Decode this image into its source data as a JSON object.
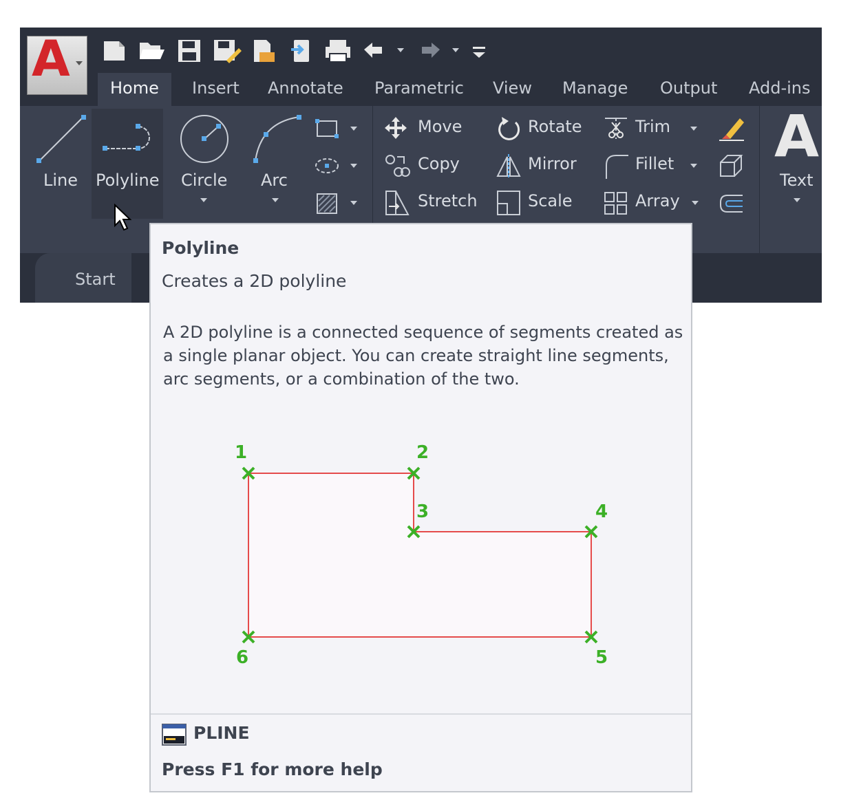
{
  "app_button": {
    "letter": "A"
  },
  "quick_access_icons": [
    "new-icon",
    "open-icon",
    "save-icon",
    "save-as-icon",
    "open-from-web-icon",
    "save-to-web-icon",
    "print-icon",
    "undo-icon",
    "redo-icon",
    "customize-qat-icon"
  ],
  "tabs": [
    {
      "label": "Home",
      "active": true
    },
    {
      "label": "Insert"
    },
    {
      "label": "Annotate"
    },
    {
      "label": "Parametric"
    },
    {
      "label": "View"
    },
    {
      "label": "Manage"
    },
    {
      "label": "Output"
    },
    {
      "label": "Add-ins"
    }
  ],
  "draw_panel": {
    "line": "Line",
    "polyline": "Polyline",
    "circle": "Circle",
    "arc": "Arc"
  },
  "modify_panel": {
    "move": "Move",
    "copy": "Copy",
    "stretch": "Stretch",
    "rotate": "Rotate",
    "mirror": "Mirror",
    "scale": "Scale",
    "trim": "Trim",
    "fillet": "Fillet",
    "array": "Array"
  },
  "annotation_panel": {
    "text": "Text",
    "text_glyph": "A"
  },
  "file_tab": {
    "start": "Start"
  },
  "tooltip": {
    "title": "Polyline",
    "subtitle": "Creates a 2D polyline",
    "description": "A 2D polyline is a connected sequence of segments created as a single planar object. You can create straight line segments, arc segments, or a combination of the two.",
    "command": "PLINE",
    "help": "Press F1 for more help"
  },
  "diagram_points": [
    "1",
    "2",
    "3",
    "4",
    "5",
    "6"
  ],
  "colors": {
    "ribbon_bg": "#3b4150",
    "app_bg": "#2b303c",
    "tooltip_bg": "#f4f4f8",
    "polyline_red": "#e54b4b",
    "vertex_green": "#3cb027",
    "accent_blue": "#5aa9ea",
    "logo_red": "#d3252a"
  }
}
